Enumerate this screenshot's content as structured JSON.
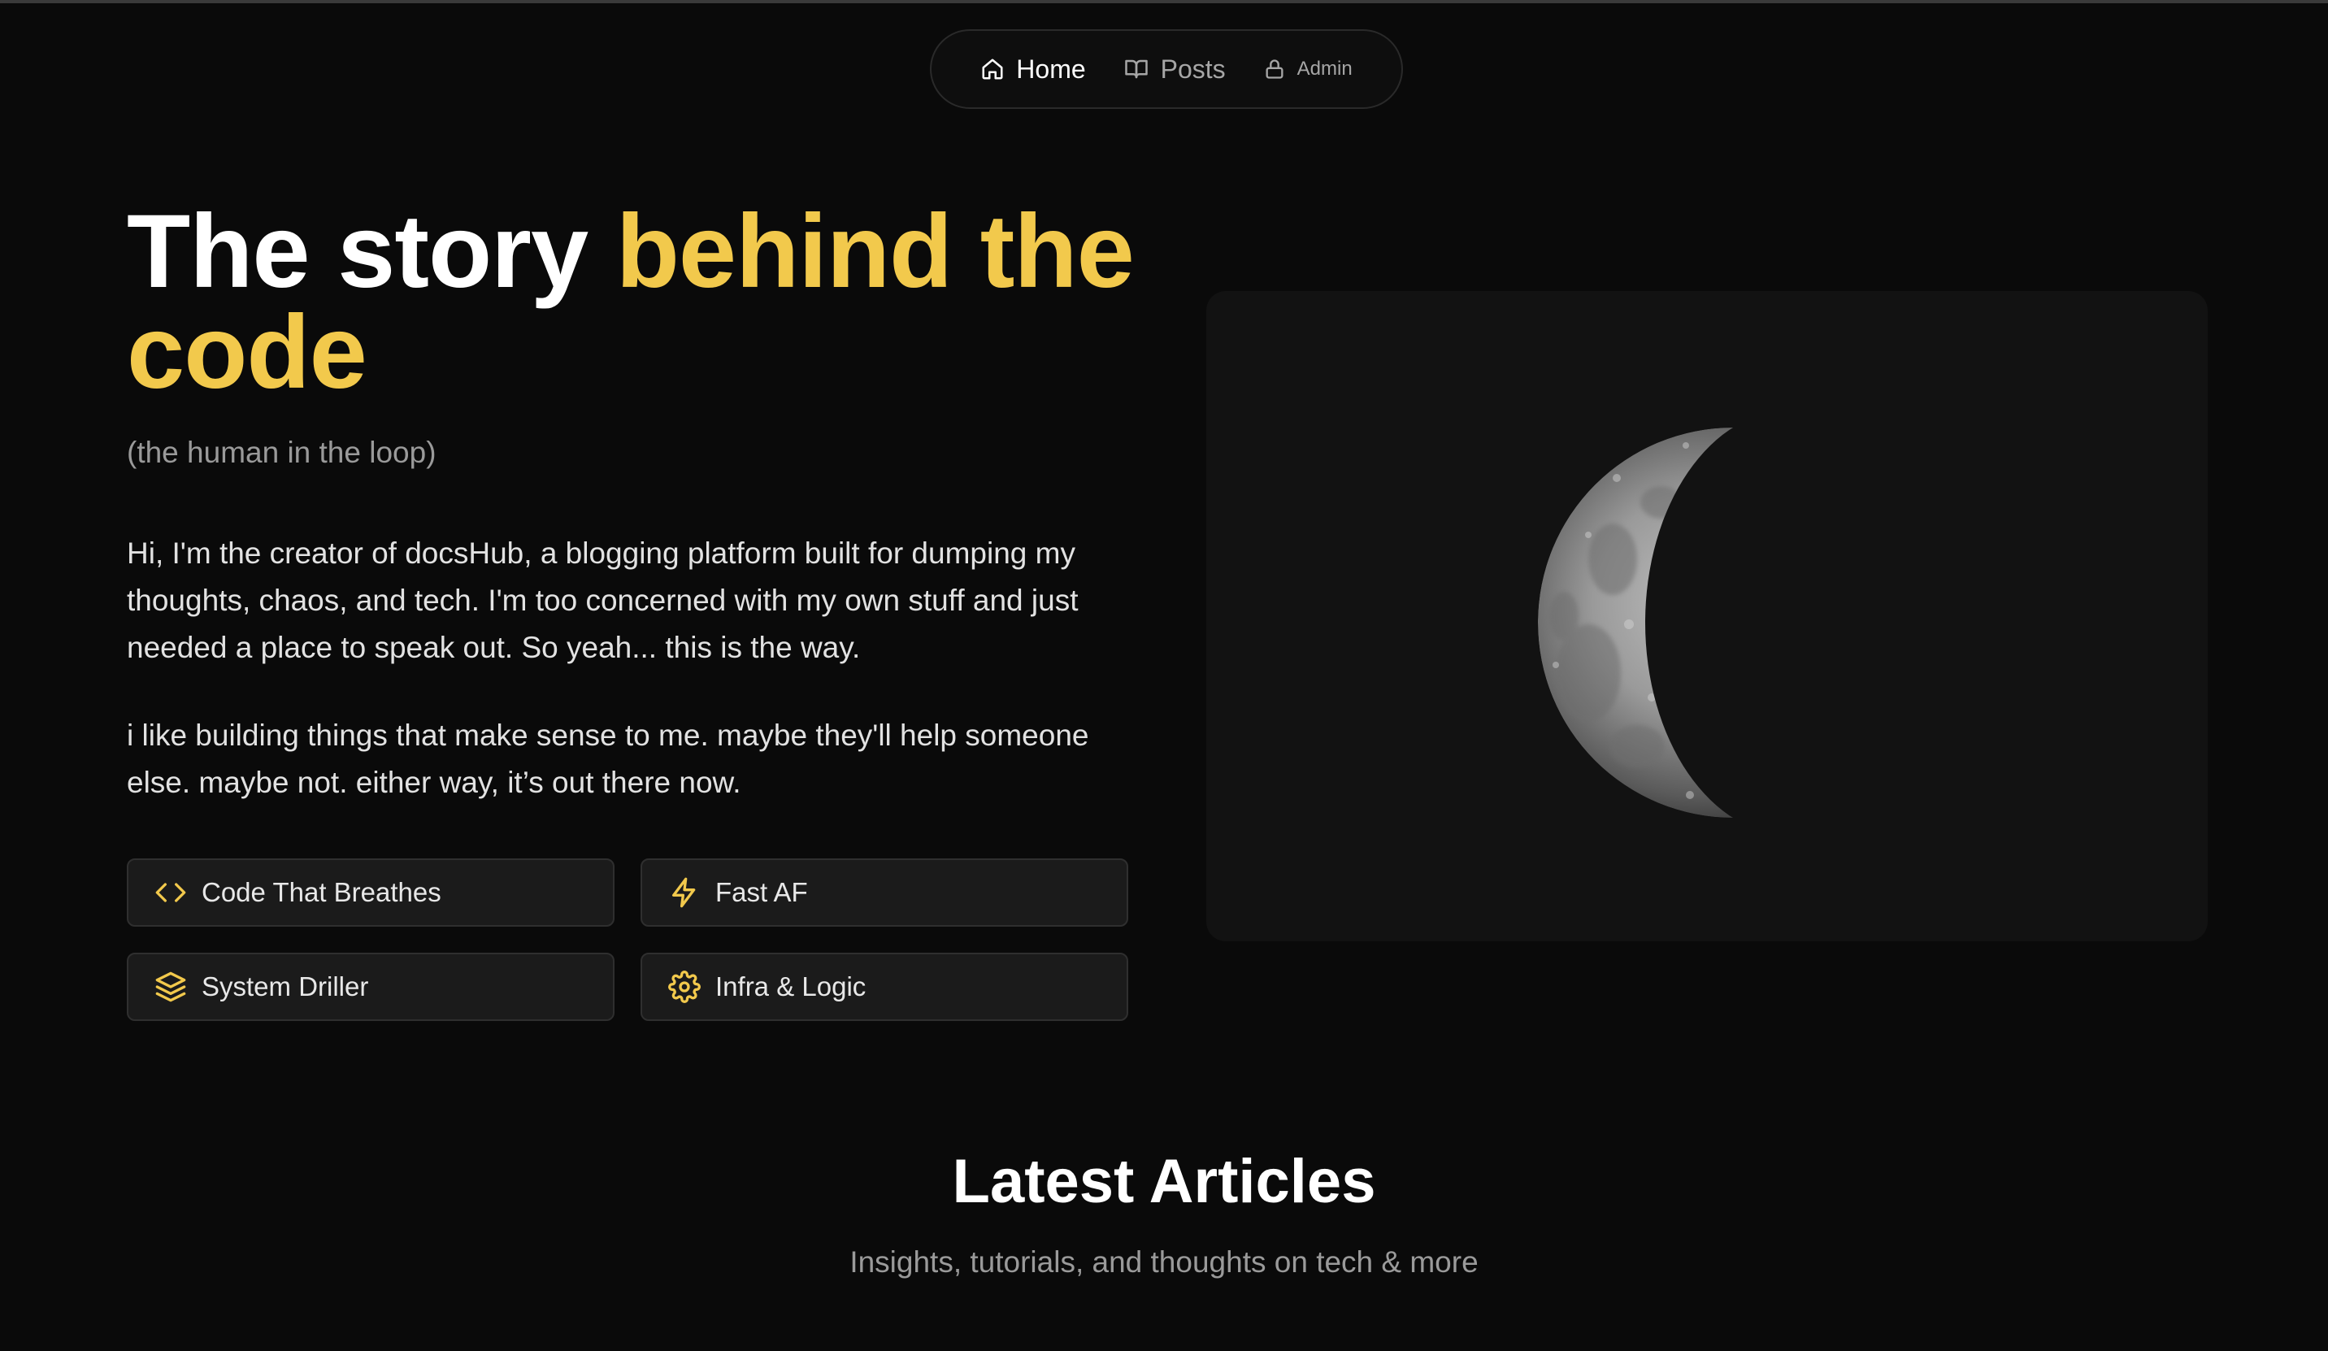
{
  "nav": {
    "items": [
      {
        "label": "Home",
        "icon": "home-icon",
        "active": true
      },
      {
        "label": "Posts",
        "icon": "book-open-icon",
        "active": false
      },
      {
        "label": "Admin",
        "icon": "lock-icon",
        "active": false
      }
    ]
  },
  "hero": {
    "title_plain": "The story ",
    "title_accent": "behind the code",
    "subtitle": "(the human in the loop)",
    "paragraph_1": "Hi, I'm the creator of docsHub, a blogging platform built for dumping my thoughts, chaos, and tech. I'm too concerned with my own stuff and just needed a place to speak out. So yeah... this is the way.",
    "paragraph_2": "i like building things that make sense to me. maybe they'll help someone else. maybe not. either way, it’s out there now.",
    "accent_color": "#f2c94c"
  },
  "features": [
    {
      "label": "Code That Breathes",
      "icon": "code-icon"
    },
    {
      "label": "Fast AF",
      "icon": "lightning-icon"
    },
    {
      "label": "System Driller",
      "icon": "layers-icon"
    },
    {
      "label": "Infra & Logic",
      "icon": "gear-icon"
    }
  ],
  "hero_image": {
    "subject": "crescent moon"
  },
  "latest": {
    "title": "Latest Articles",
    "subtitle": "Insights, tutorials, and thoughts on tech & more"
  }
}
